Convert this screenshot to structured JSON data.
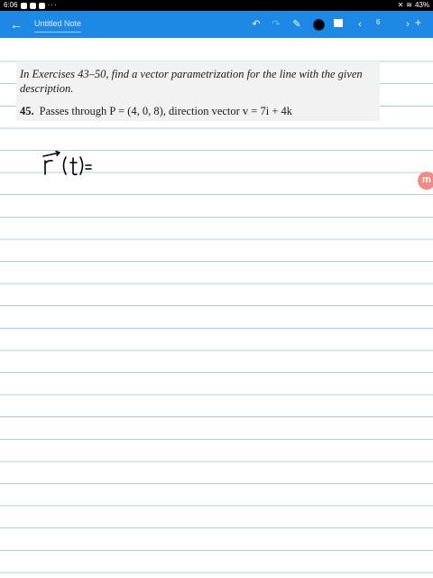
{
  "status_bar": {
    "time": "6:06",
    "battery": "43%"
  },
  "app_bar": {
    "note_title": "Untitled Note",
    "page_number": "6",
    "accent_color": "#1e88e5",
    "selected_pen_color": "#000000"
  },
  "icons": {
    "back": "arrow-left",
    "undo": "undo",
    "redo": "redo",
    "pen": "pen",
    "image": "image",
    "prev_page": "chevron-left",
    "next_page": "chevron-right",
    "add_page": "plus"
  },
  "page": {
    "excerpt": {
      "instructions": "In Exercises 43–50, find a vector parametrization for the line with the given description.",
      "problem_number": "45.",
      "problem_text": "Passes through P = (4, 0, 8), direction vector v = 7i + 4k"
    },
    "handwriting": "r⃗(t)="
  }
}
